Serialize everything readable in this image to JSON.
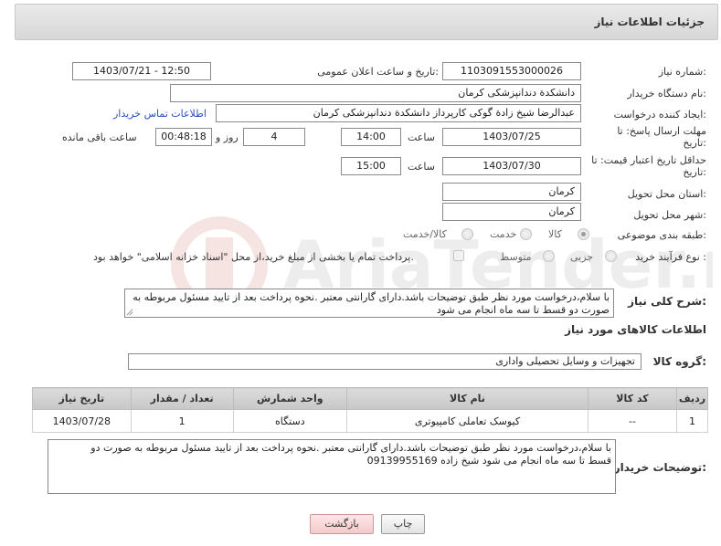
{
  "header": {
    "title": "جزئیات اطلاعات نیاز"
  },
  "form": {
    "need_number": {
      "label": "شماره نیاز:",
      "value": "1103091553000026"
    },
    "announce_datetime": {
      "label": "تاریخ و ساعت اعلان عمومی:",
      "value": "1403/07/21 - 12:50"
    },
    "buyer_org": {
      "label": "نام دستگاه خریدار:",
      "value": "دانشکدة دندانپزشکی کرمان"
    },
    "creator": {
      "label": "ایجاد کننده درخواست:",
      "value": "عبدالرضا شیخ زادة گوکی کارپرداز دانشکدة دندانپزشکی کرمان"
    },
    "contact_link": "اطلاعات تماس خریدار",
    "reply_deadline": {
      "label_line1": "مهلت ارسال پاسخ: تا",
      "label_line2": "تاریخ:",
      "date": "1403/07/25",
      "time_label": "ساعت",
      "time": "14:00",
      "days": "4",
      "days_label": "روز و",
      "remaining": "00:48:18",
      "remaining_label": "ساعت باقی مانده"
    },
    "price_validity": {
      "label_line1": "حداقل تاریخ اعتبار قیمت: تا",
      "label_line2": "تاریخ:",
      "date": "1403/07/30",
      "time_label": "ساعت",
      "time": "15:00"
    },
    "province": {
      "label": "استان محل تحویل:",
      "value": "کرمان"
    },
    "city": {
      "label": "شهر محل تحویل:",
      "value": "کرمان"
    },
    "category": {
      "label": "طبقه بندی موضوعی:",
      "options": [
        "کالا",
        "خدمت",
        "کالا/خدمت"
      ]
    },
    "purchase_type": {
      "label": "نوع فرآیند خرید :",
      "options": [
        "جزیی",
        "متوسط"
      ],
      "note": "پرداخت تمام یا بخشی از مبلغ خرید،از محل \"اسناد خزانه اسلامی\" خواهد بود."
    },
    "general_desc": {
      "label": "شرح کلی نیاز:",
      "value": "با سلام،درخواست مورد نظر طبق توضیحات باشد.دارای گارانتی معتبر .نحوه پرداخت بعد از تایید مسئول مربوطه به صورت دو قسط تا سه ماه انجام می شود"
    }
  },
  "goods": {
    "section_title": "اطلاعات کالاهای مورد نیاز",
    "group_label": "گروه کالا:",
    "group_value": "تجهیزات و وسایل تحصیلی واداری",
    "columns": [
      "ردیف",
      "کد کالا",
      "نام کالا",
      "واحد شمارش",
      "تعداد / مقدار",
      "تاریخ نیاز"
    ],
    "rows": [
      {
        "row": "1",
        "code": "--",
        "name": "کیوسک تعاملی کامپیوتری",
        "unit": "دستگاه",
        "qty": "1",
        "date": "1403/07/28"
      }
    ]
  },
  "buyer_notes": {
    "label": "توضیحات خریدار:",
    "line1": "با سلام،درخواست مورد نظر طبق توضیحات باشد.دارای گارانتی معتبر .نحوه پرداخت بعد از تایید مسئول مربوطه به صورت دو",
    "line2": "قسط تا سه ماه انجام می شود     شیخ زاده 09139955169"
  },
  "buttons": {
    "print": "چاپ",
    "back": "بازگشت"
  },
  "watermark": {
    "text": "AriaTender.neT"
  },
  "colors": {
    "link": "#2a4fbf",
    "header_bg": "#dcdcdc",
    "back_button": "#f3caca"
  }
}
